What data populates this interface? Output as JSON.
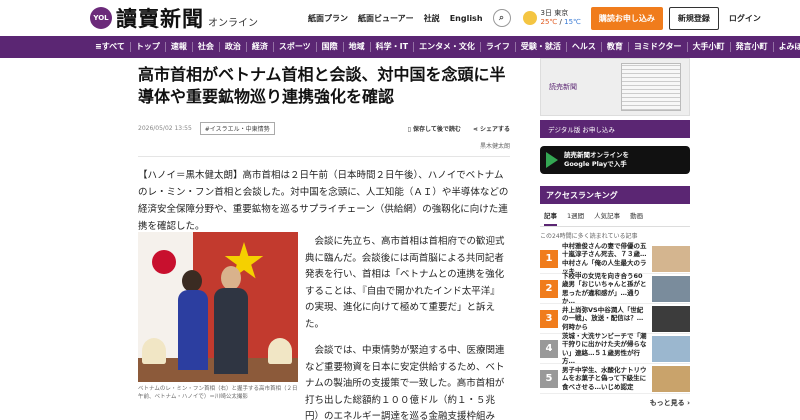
{
  "header": {
    "logo_badge": "YOL",
    "logo_name": "讀賣新聞",
    "logo_sub": "オンライン",
    "links": [
      "紙面プラン",
      "紙面ビューアー",
      "社説",
      "English"
    ],
    "weather": {
      "city": "3日 東京",
      "high": "25℃",
      "low": "15℃"
    },
    "subscribe_button": "購読お申し込み",
    "register_button": "新規登録",
    "login": "ログイン"
  },
  "nav": {
    "items": [
      "≡すべて",
      "トップ",
      "速報",
      "社会",
      "政治",
      "経済",
      "スポーツ",
      "国際",
      "地域",
      "科学・IT",
      "エンタメ・文化",
      "ライフ",
      "受験・就活",
      "ヘルス",
      "教育",
      "ヨミドクター",
      "大手小町",
      "発言小町",
      "よみぼランド"
    ]
  },
  "article": {
    "headline": "高市首相がベトナム首相と会談、対中国を念頭に半導体や重要鉱物巡り連携強化を確認",
    "date": "2026/05/02 13:55",
    "tag": "#イスラエル・中東情勢",
    "save_label": "保存して後で読む",
    "share_label": "シェアする",
    "byline": "黒木健太朗",
    "lead": "【ハノイ＝黒木健太朗】高市首相は２日午前（日本時間２日午後）、ハノイでベトナムのレ・ミン・フン首相と会談した。対中国を念頭に、人工知能（ＡＩ）や半導体などの経済安全保障分野や、重要鉱物を巡るサプライチェーン（供給網）の強靱化に向けた連携を確認した。",
    "photo_caption": "ベトナムのレ・ミン・フン首相（右）と握手する高市首相（２日午前、ベトナム・ハノイで）＝川崎公太撮影",
    "paragraphs": [
      "会談に先立ち、高市首相は首相府での歓迎式典に臨んだ。会談後には両首脳による共同記者発表を行い、首相は「ベトナムとの連携を強化することは、『自由で開かれたインド太平洋』の実現、進化に向けて極めて重要だ」と訴えた。",
      "会談では、中東情勢が緊迫する中、医療関連など重要物資を日本に安定供給するため、ベトナムの製油所の支援策で一致した。高市首相が打ち出した総額約１００億ドル（約１・５兆円）のエネルギー調達を巡る金融支援枠組み"
    ]
  },
  "sidebar": {
    "ad_paper_text": "読売新聞",
    "ad_digital_text": "デジタル版 お申し込み",
    "gplay_line1": "読売新聞オンラインを",
    "gplay_line2": "Google Playで入手",
    "ranking_title": "アクセスランキング",
    "tabs": [
      "記事",
      "1週間",
      "人気記事",
      "動画"
    ],
    "note": "この24時間に多く読まれている記事",
    "items": [
      {
        "rank": "1",
        "text": "中村雅俊さんの妻で俳優の五十嵐淳子さん死去、７３歳…中村さん「俺の人生最大のラッキ…",
        "thumb": "#d4b58f"
      },
      {
        "rank": "2",
        "text": "下校中の女児を向き合う60歳男「おじいちゃんと孫がと思ったが違和感が」…通りか…",
        "thumb": "#7a8c9c"
      },
      {
        "rank": "3",
        "text": "井上尚弥VS中谷潤人「世紀の一戦」、放送・配信は？…何時から",
        "thumb": "#3c3c3c"
      },
      {
        "rank": "4",
        "text": "茨城・大洗サンビーチで「潮干狩りに出かけた夫が帰らない」連絡…５１歳男性が行方…",
        "thumb": "#9bb7cf"
      },
      {
        "rank": "5",
        "text": "男子中学生、水酸化ナトリウムをお菓子と偽って下級生に食べさせる…いじめ認定",
        "thumb": "#c9a36b"
      }
    ],
    "more": "もっと見る ›"
  }
}
